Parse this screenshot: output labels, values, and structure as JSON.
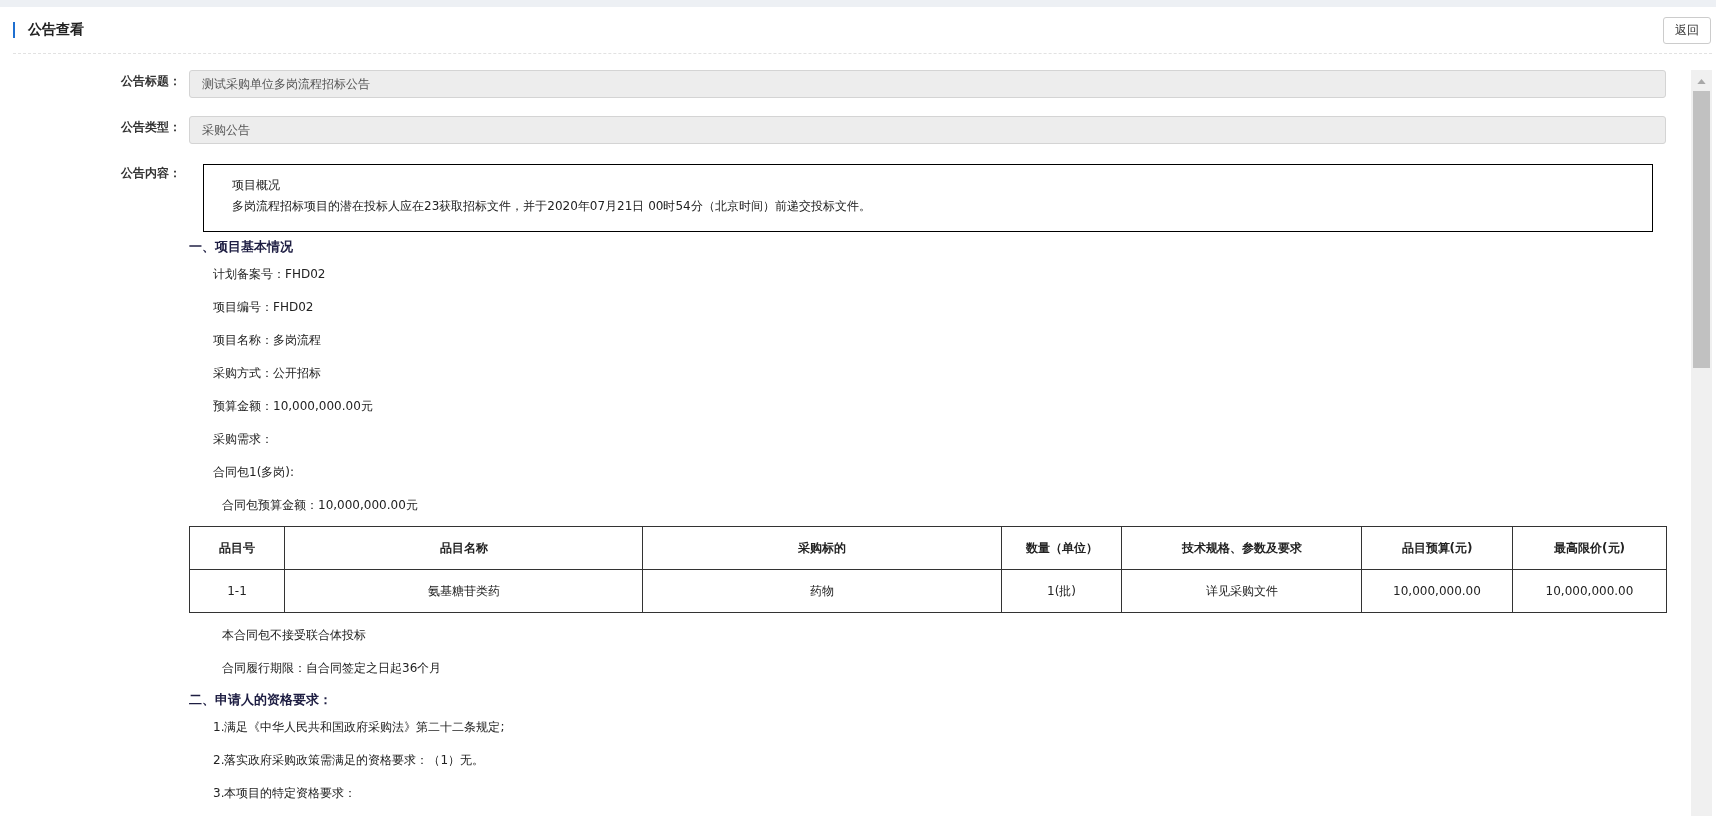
{
  "header": {
    "title": "公告查看",
    "back_button": "返回"
  },
  "fields": [
    {
      "label": "公告标题：",
      "value": "测试采购单位多岗流程招标公告"
    },
    {
      "label": "公告类型：",
      "value": "采购公告"
    }
  ],
  "content": {
    "label": "公告内容：",
    "overview_title": "项目概况",
    "overview_text": "多岗流程招标项目的潜在投标人应在23获取招标文件，并于2020年07月21日 00时54分（北京时间）前递交投标文件。",
    "blocks": [
      {
        "kind": "heading",
        "text": "一、项目基本情况"
      },
      {
        "kind": "line",
        "text": "计划备案号：FHD02"
      },
      {
        "kind": "line",
        "text": "项目编号：FHD02"
      },
      {
        "kind": "line",
        "text": "项目名称：多岗流程"
      },
      {
        "kind": "line",
        "text": "采购方式：公开招标"
      },
      {
        "kind": "line",
        "text": "预算金额：10,000,000.00元"
      },
      {
        "kind": "line",
        "text": "采购需求："
      },
      {
        "kind": "line",
        "text": "合同包1(多岗):"
      },
      {
        "kind": "subline",
        "text": "合同包预算金额：10,000,000.00元"
      },
      {
        "kind": "table",
        "columns": [
          "品目号",
          "品目名称",
          "采购标的",
          "数量（单位）",
          "技术规格、参数及要求",
          "品目预算(元)",
          "最高限价(元)"
        ],
        "rows": [
          [
            "1-1",
            "氨基糖苷类药",
            "药物",
            "1(批)",
            "详见采购文件",
            "10,000,000.00",
            "10,000,000.00"
          ]
        ]
      },
      {
        "kind": "subline",
        "text": "本合同包不接受联合体投标"
      },
      {
        "kind": "subline",
        "text": "合同履行期限：自合同签定之日起36个月"
      },
      {
        "kind": "heading",
        "text": "二、申请人的资格要求："
      },
      {
        "kind": "line",
        "text": "1.满足《中华人民共和国政府采购法》第二十二条规定;"
      },
      {
        "kind": "line",
        "text": "2.落实政府采购政策需满足的资格要求：（1）无。"
      },
      {
        "kind": "line",
        "text": "3.本项目的特定资格要求："
      }
    ]
  }
}
